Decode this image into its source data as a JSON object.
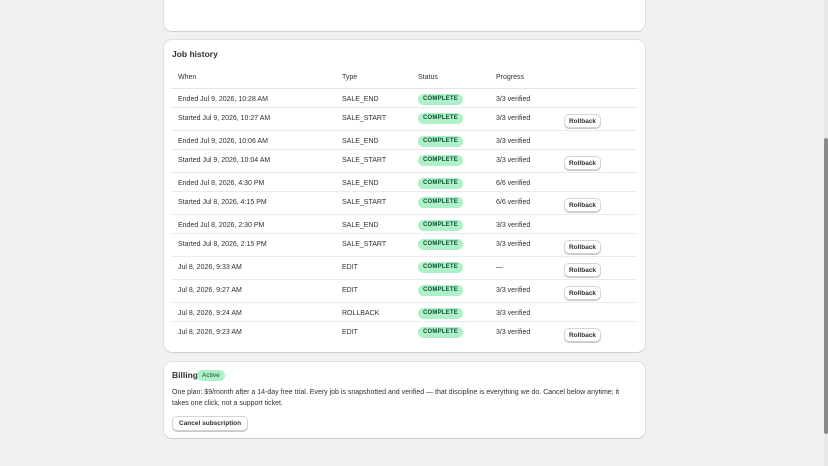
{
  "job_history": {
    "title": "Job history",
    "columns": [
      "When",
      "Type",
      "Status",
      "Progress"
    ],
    "rows": [
      {
        "when": "Ended Jul 9, 2026, 10:28 AM",
        "type": "SALE_END",
        "status": "COMPLETE",
        "progress": "3/3 verified",
        "action": ""
      },
      {
        "when": "Started Jul 9, 2026, 10:27 AM",
        "type": "SALE_START",
        "status": "COMPLETE",
        "progress": "3/3 verified",
        "action": "Rollback"
      },
      {
        "when": "Ended Jul 9, 2026, 10:06 AM",
        "type": "SALE_END",
        "status": "COMPLETE",
        "progress": "3/3 verified",
        "action": ""
      },
      {
        "when": "Started Jul 9, 2026, 10:04 AM",
        "type": "SALE_START",
        "status": "COMPLETE",
        "progress": "3/3 verified",
        "action": "Rollback"
      },
      {
        "when": "Ended Jul 8, 2026, 4:30 PM",
        "type": "SALE_END",
        "status": "COMPLETE",
        "progress": "6/6 verified",
        "action": ""
      },
      {
        "when": "Started Jul 8, 2026, 4:15 PM",
        "type": "SALE_START",
        "status": "COMPLETE",
        "progress": "6/6 verified",
        "action": "Rollback"
      },
      {
        "when": "Ended Jul 8, 2026, 2:30 PM",
        "type": "SALE_END",
        "status": "COMPLETE",
        "progress": "3/3 verified",
        "action": ""
      },
      {
        "when": "Started Jul 8, 2026, 2:15 PM",
        "type": "SALE_START",
        "status": "COMPLETE",
        "progress": "3/3 verified",
        "action": "Rollback"
      },
      {
        "when": "Jul 8, 2026, 9:33 AM",
        "type": "EDIT",
        "status": "COMPLETE",
        "progress": "—",
        "action": "Rollback"
      },
      {
        "when": "Jul 8, 2026, 9:27 AM",
        "type": "EDIT",
        "status": "COMPLETE",
        "progress": "3/3 verified",
        "action": "Rollback"
      },
      {
        "when": "Jul 8, 2026, 9:24 AM",
        "type": "ROLLBACK",
        "status": "COMPLETE",
        "progress": "3/3 verified",
        "action": ""
      },
      {
        "when": "Jul 8, 2026, 9:23 AM",
        "type": "EDIT",
        "status": "COMPLETE",
        "progress": "3/3 verified",
        "action": "Rollback"
      }
    ]
  },
  "billing": {
    "title": "Billing",
    "status_badge": "Active",
    "description": "One plan: $9/month after a 14-day free trial. Every job is snapshotted and verified — that discipline is everything we do. Cancel below anytime; it takes one click, not a support ticket.",
    "cancel_label": "Cancel subscription"
  },
  "colors": {
    "page_background": "#f1f1f1",
    "card_background": "#ffffff",
    "success_badge_background": "#aef1c8",
    "success_badge_text": "#0c5132"
  }
}
